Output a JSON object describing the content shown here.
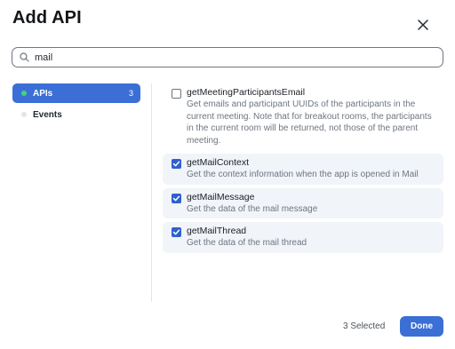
{
  "dialog": {
    "title": "Add API",
    "close_icon": "close-icon"
  },
  "search": {
    "value": "mail",
    "placeholder": "",
    "icon": "search-icon"
  },
  "sidebar": {
    "items": [
      {
        "label": "APIs",
        "count": "3",
        "active": true
      },
      {
        "label": "Events",
        "count": "",
        "active": false
      }
    ]
  },
  "apis": [
    {
      "name": "getMeetingParticipantsEmail",
      "description": "Get emails and participant UUIDs of the participants in the current meeting. Note that for breakout rooms, the participants in the current room will be returned, not those of the parent meeting.",
      "checked": false
    },
    {
      "name": "getMailContext",
      "description": "Get the context information when the app is opened in Mail",
      "checked": true
    },
    {
      "name": "getMailMessage",
      "description": "Get the data of the mail message",
      "checked": true
    },
    {
      "name": "getMailThread",
      "description": "Get the data of the mail thread",
      "checked": true
    }
  ],
  "footer": {
    "selected_count": "3 Selected",
    "done_label": "Done"
  },
  "colors": {
    "accent": "#3b6fd6",
    "checkbox_on": "#2f5fd0",
    "active_dot": "#43d17a"
  }
}
